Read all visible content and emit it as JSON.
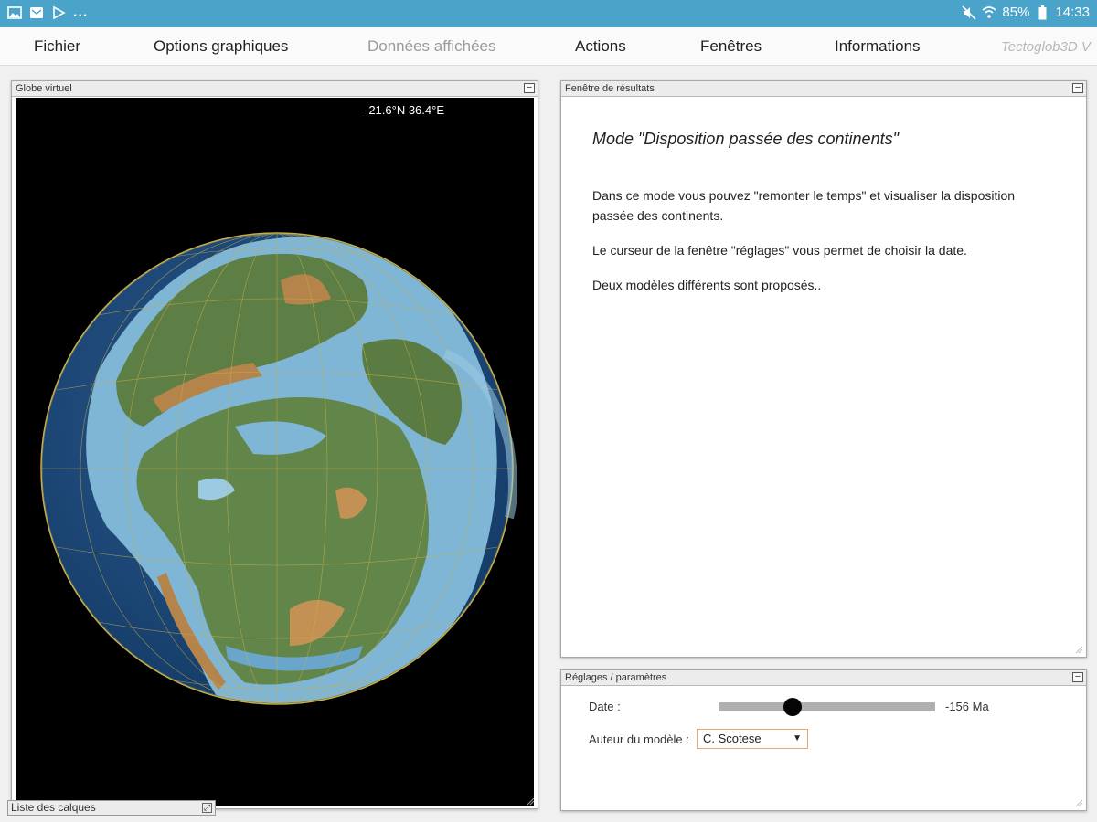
{
  "status_bar": {
    "icons": [
      "image-icon",
      "message-icon",
      "play-store-icon"
    ],
    "more": "...",
    "right_icons": [
      "mute-icon",
      "wifi-icon"
    ],
    "battery": "85%",
    "time": "14:33",
    "bg_color": "#4aa3c8"
  },
  "menu": {
    "items": [
      {
        "label": "Fichier",
        "enabled": true
      },
      {
        "label": "Options graphiques",
        "enabled": true
      },
      {
        "label": "Données affichées",
        "enabled": false
      },
      {
        "label": "Actions",
        "enabled": true
      },
      {
        "label": "Fenêtres",
        "enabled": true
      },
      {
        "label": "Informations",
        "enabled": true
      }
    ],
    "brand": "Tectoglob3D V"
  },
  "globe_panel": {
    "title": "Globe virtuel",
    "coordinates": "-21.6°N  36.4°E"
  },
  "layer_list": {
    "title": "Liste des calques"
  },
  "results_panel": {
    "title": "Fenêtre de résultats",
    "heading": "Mode \"Disposition passée des continents\"",
    "paragraphs": [
      "Dans ce mode vous pouvez \"remonter le temps\" et visualiser la disposition passée des continents.",
      "Le curseur de la fenêtre \"réglages\" vous permet de choisir la date.",
      "Deux modèles différents sont proposés.."
    ]
  },
  "settings_panel": {
    "title": "Réglages / paramètres",
    "date_label": "Date :",
    "date_value": "-156 Ma",
    "slider_fraction": 0.34,
    "model_label": "Auteur du modèle :",
    "model_selected": "C. Scotese"
  },
  "colors": {
    "ocean": "#1b3f6b",
    "land": "#5d7f45",
    "shelf": "#7fb6d6",
    "mountain": "#b5844a",
    "select_border": "#e0a878"
  }
}
